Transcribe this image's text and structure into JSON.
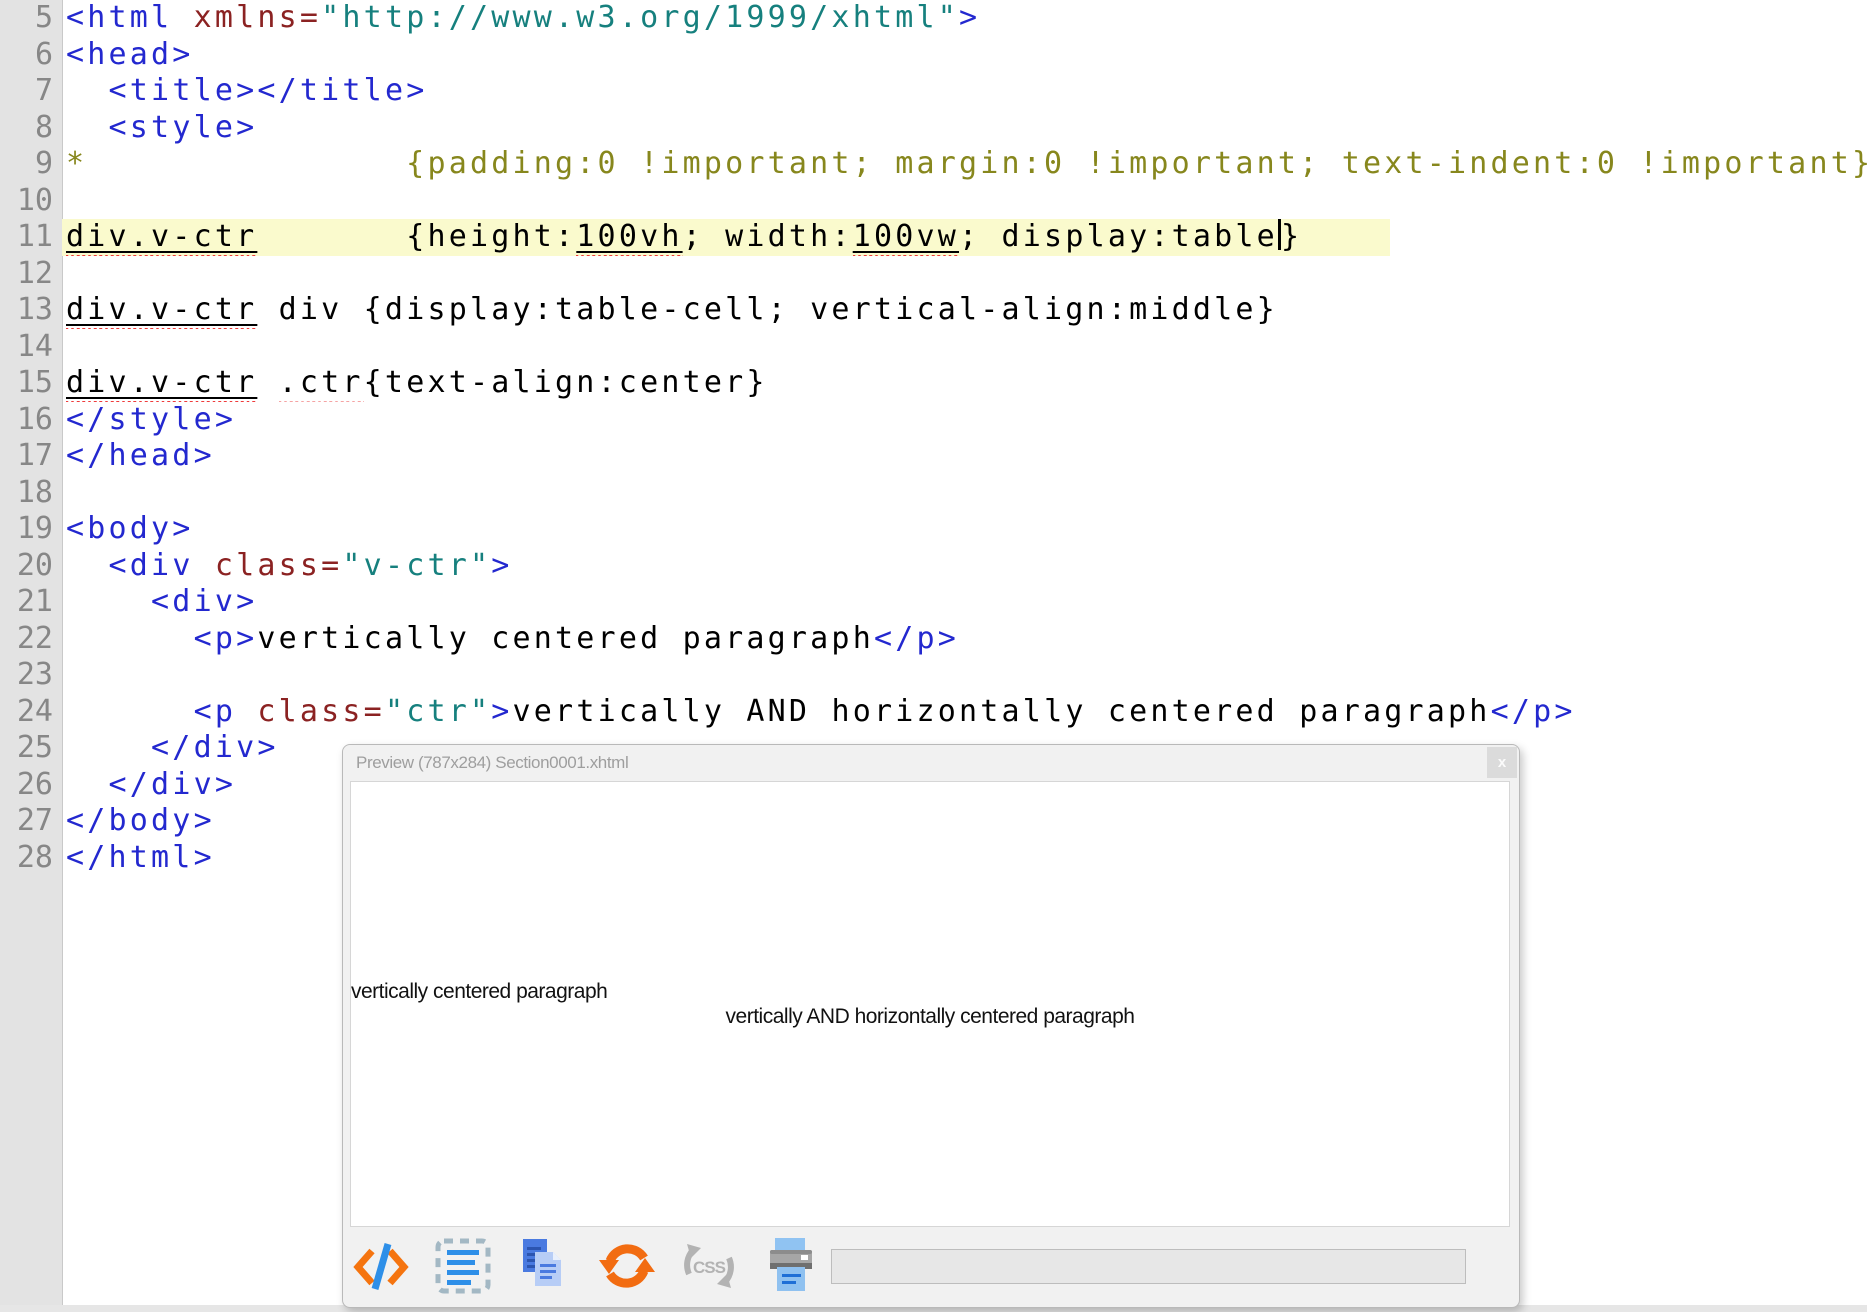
{
  "colors": {
    "tag_blue": "#2328cf",
    "attr_red": "#8b2222",
    "value_teal": "#16807e",
    "css_olive": "#87871d",
    "current_line_yellow": "#fafacd",
    "squiggle_red": "#ef3b3b",
    "icon_orange": "#f5740f",
    "icon_blue": "#2e8fe8",
    "gutter_gray": "#e3e3e3"
  },
  "editor": {
    "lines": [
      {
        "n": 5,
        "tokens": [
          [
            "tag",
            "<html"
          ],
          [
            "plain",
            " "
          ],
          [
            "attr",
            "xmlns="
          ],
          [
            "val",
            "\"http://www.w3.org/1999/xhtml\""
          ],
          [
            "tag",
            ">"
          ]
        ]
      },
      {
        "n": 6,
        "tokens": [
          [
            "tag",
            "<head>"
          ]
        ]
      },
      {
        "n": 7,
        "tokens": [
          [
            "plain",
            "  "
          ],
          [
            "tag",
            "<title>"
          ],
          [
            "tag",
            "</title>"
          ]
        ]
      },
      {
        "n": 8,
        "tokens": [
          [
            "plain",
            "  "
          ],
          [
            "tag",
            "<style>"
          ]
        ]
      },
      {
        "n": 9,
        "tokens": [
          [
            "css",
            "*               {padding:0 !important; margin:0 !important; text-indent:0 !important}"
          ]
        ]
      },
      {
        "n": 10,
        "tokens": []
      },
      {
        "n": 11,
        "current": true,
        "tokens": [
          [
            "usq",
            "div.v-ctr"
          ],
          [
            "plain",
            "       {height:"
          ],
          [
            "usq",
            "100vh"
          ],
          [
            "plain",
            "; width:"
          ],
          [
            "usq",
            "100vw"
          ],
          [
            "plain",
            "; display:table"
          ],
          [
            "caret",
            ""
          ],
          [
            "plain",
            "}"
          ]
        ]
      },
      {
        "n": 12,
        "tokens": []
      },
      {
        "n": 13,
        "tokens": [
          [
            "usq",
            "div.v-ctr"
          ],
          [
            "plain",
            " div {display:table-cell; vertical-align:middle}"
          ]
        ]
      },
      {
        "n": 14,
        "tokens": []
      },
      {
        "n": 15,
        "tokens": [
          [
            "usq",
            "div.v-ctr"
          ],
          [
            "plain",
            " "
          ],
          [
            "sq",
            ".ctr"
          ],
          [
            "plain",
            "{text-align:center}"
          ]
        ]
      },
      {
        "n": 16,
        "tokens": [
          [
            "tag",
            "</style>"
          ]
        ]
      },
      {
        "n": 17,
        "tokens": [
          [
            "tag",
            "</head>"
          ]
        ]
      },
      {
        "n": 18,
        "tokens": []
      },
      {
        "n": 19,
        "tokens": [
          [
            "tag",
            "<body>"
          ]
        ]
      },
      {
        "n": 20,
        "tokens": [
          [
            "plain",
            "  "
          ],
          [
            "tag",
            "<div"
          ],
          [
            "plain",
            " "
          ],
          [
            "attr",
            "class="
          ],
          [
            "val",
            "\"v-ctr\""
          ],
          [
            "tag",
            ">"
          ]
        ]
      },
      {
        "n": 21,
        "tokens": [
          [
            "plain",
            "    "
          ],
          [
            "tag",
            "<div>"
          ]
        ]
      },
      {
        "n": 22,
        "tokens": [
          [
            "plain",
            "      "
          ],
          [
            "tag",
            "<p>"
          ],
          [
            "plain",
            "vertically centered paragraph"
          ],
          [
            "tag",
            "</p>"
          ]
        ]
      },
      {
        "n": 23,
        "tokens": []
      },
      {
        "n": 24,
        "tokens": [
          [
            "plain",
            "      "
          ],
          [
            "tag",
            "<p"
          ],
          [
            "plain",
            " "
          ],
          [
            "attr",
            "class="
          ],
          [
            "val",
            "\"ctr\""
          ],
          [
            "tag",
            ">"
          ],
          [
            "plain",
            "vertically AND horizontally centered paragraph"
          ],
          [
            "tag",
            "</p>"
          ]
        ]
      },
      {
        "n": 25,
        "tokens": [
          [
            "plain",
            "    "
          ],
          [
            "tag",
            "</div>"
          ]
        ]
      },
      {
        "n": 26,
        "tokens": [
          [
            "plain",
            "  "
          ],
          [
            "tag",
            "</div>"
          ]
        ]
      },
      {
        "n": 27,
        "tokens": [
          [
            "tag",
            "</body>"
          ]
        ]
      },
      {
        "n": 28,
        "tokens": [
          [
            "tag",
            "</html>"
          ]
        ]
      }
    ]
  },
  "preview": {
    "title": "Preview (787x284) Section0001.xhtml",
    "close_label": "x",
    "paragraphs": [
      "vertically centered paragraph",
      "vertically AND horizontally centered paragraph"
    ],
    "toolbar": {
      "icons": [
        "code-view-icon",
        "select-all-icon",
        "copy-icon",
        "refresh-icon",
        "inspect-css-icon",
        "print-icon"
      ],
      "css_label": "CSS",
      "address_value": ""
    }
  }
}
